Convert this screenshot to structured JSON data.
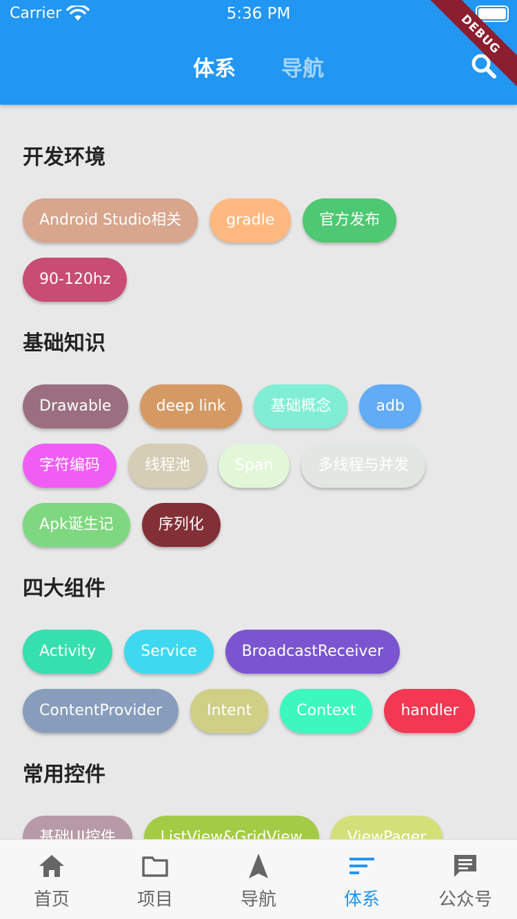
{
  "status_bar": {
    "carrier": "Carrier",
    "time": "5:36 PM"
  },
  "app_bar": {
    "tabs": [
      {
        "label": "体系",
        "active": true
      },
      {
        "label": "导航",
        "active": false
      }
    ],
    "debug_banner": "DEBUG",
    "color": "#2196f3"
  },
  "sections": [
    {
      "title": "开发环境",
      "chips": [
        {
          "label": "Android Studio相关",
          "color": "#d8a68c"
        },
        {
          "label": "gradle",
          "color": "#ffb980"
        },
        {
          "label": "官方发布",
          "color": "#4ec872"
        },
        {
          "label": "90-120hz",
          "color": "#c84c74"
        }
      ]
    },
    {
      "title": "基础知识",
      "chips": [
        {
          "label": "Drawable",
          "color": "#9c6f80"
        },
        {
          "label": "deep link",
          "color": "#d59a64"
        },
        {
          "label": "基础概念",
          "color": "#7feed5"
        },
        {
          "label": "adb",
          "color": "#62abf5"
        },
        {
          "label": "字符编码",
          "color": "#f05df5"
        },
        {
          "label": "线程池",
          "color": "#d5cdb5"
        },
        {
          "label": "Span",
          "color": "#e2f7d8"
        },
        {
          "label": "多线程与并发",
          "color": "#e3e7e3"
        },
        {
          "label": "Apk诞生记",
          "color": "#7ed87f"
        },
        {
          "label": "序列化",
          "color": "#832f36"
        }
      ]
    },
    {
      "title": "四大组件",
      "chips": [
        {
          "label": "Activity",
          "color": "#35dfae"
        },
        {
          "label": "Service",
          "color": "#3ed9f1"
        },
        {
          "label": "BroadcastReceiver",
          "color": "#7a55cf"
        },
        {
          "label": "ContentProvider",
          "color": "#889dbb"
        },
        {
          "label": "Intent",
          "color": "#cfcf86"
        },
        {
          "label": "Context",
          "color": "#3cf8be"
        },
        {
          "label": "handler",
          "color": "#f23853"
        }
      ]
    },
    {
      "title": "常用控件",
      "chips": [
        {
          "label": "基础UI控件",
          "color": "#b89aa6"
        },
        {
          "label": "ListView&GridView",
          "color": "#a4cb45"
        },
        {
          "label": "ViewPager",
          "color": "#d3e07a"
        }
      ]
    }
  ],
  "bottom_nav": {
    "items": [
      {
        "label": "首页",
        "icon": "home-icon",
        "active": false
      },
      {
        "label": "项目",
        "icon": "folder-icon",
        "active": false
      },
      {
        "label": "导航",
        "icon": "navigation-arrow-icon",
        "active": false
      },
      {
        "label": "体系",
        "icon": "sort-lines-icon",
        "active": true
      },
      {
        "label": "公众号",
        "icon": "chat-bubble-icon",
        "active": false
      }
    ],
    "active_color": "#2196f3"
  }
}
